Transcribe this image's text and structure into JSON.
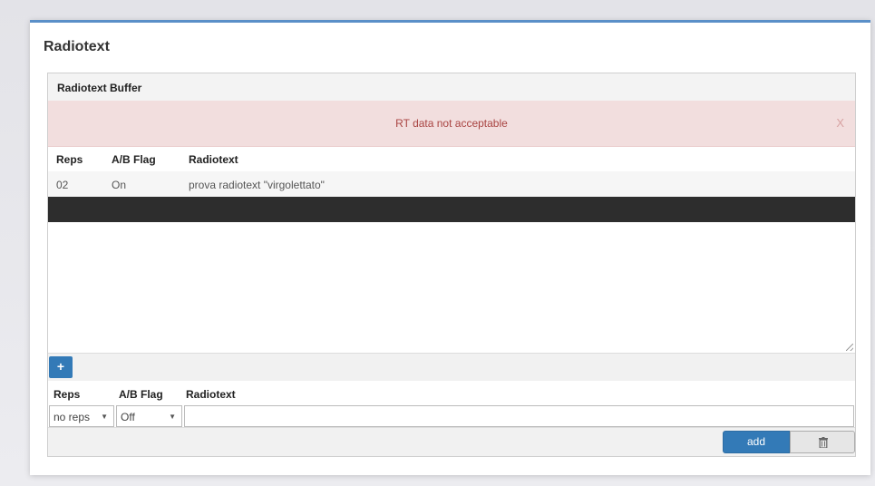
{
  "panel": {
    "title": "Radiotext"
  },
  "buffer": {
    "header": "Radiotext Buffer",
    "alert": {
      "message": "RT data not acceptable",
      "close_label": "X"
    },
    "columns": [
      "Reps",
      "A/B Flag",
      "Radiotext"
    ],
    "rows": [
      {
        "reps": "02",
        "ab_flag": "On",
        "radiotext": "prova radiotext \"virgolettato\""
      }
    ]
  },
  "toolbar": {
    "add_row_label": "+"
  },
  "input": {
    "columns": [
      "Reps",
      "A/B Flag",
      "Radiotext"
    ],
    "reps_value": "no reps",
    "ab_flag_value": "Off",
    "radiotext_value": ""
  },
  "footer": {
    "add_label": "add",
    "delete_icon": "trash-icon"
  },
  "colors": {
    "primary": "#337ab7",
    "alert_bg": "#f2dede",
    "alert_text": "#a94442",
    "selected_row": "#2d2d2d"
  }
}
